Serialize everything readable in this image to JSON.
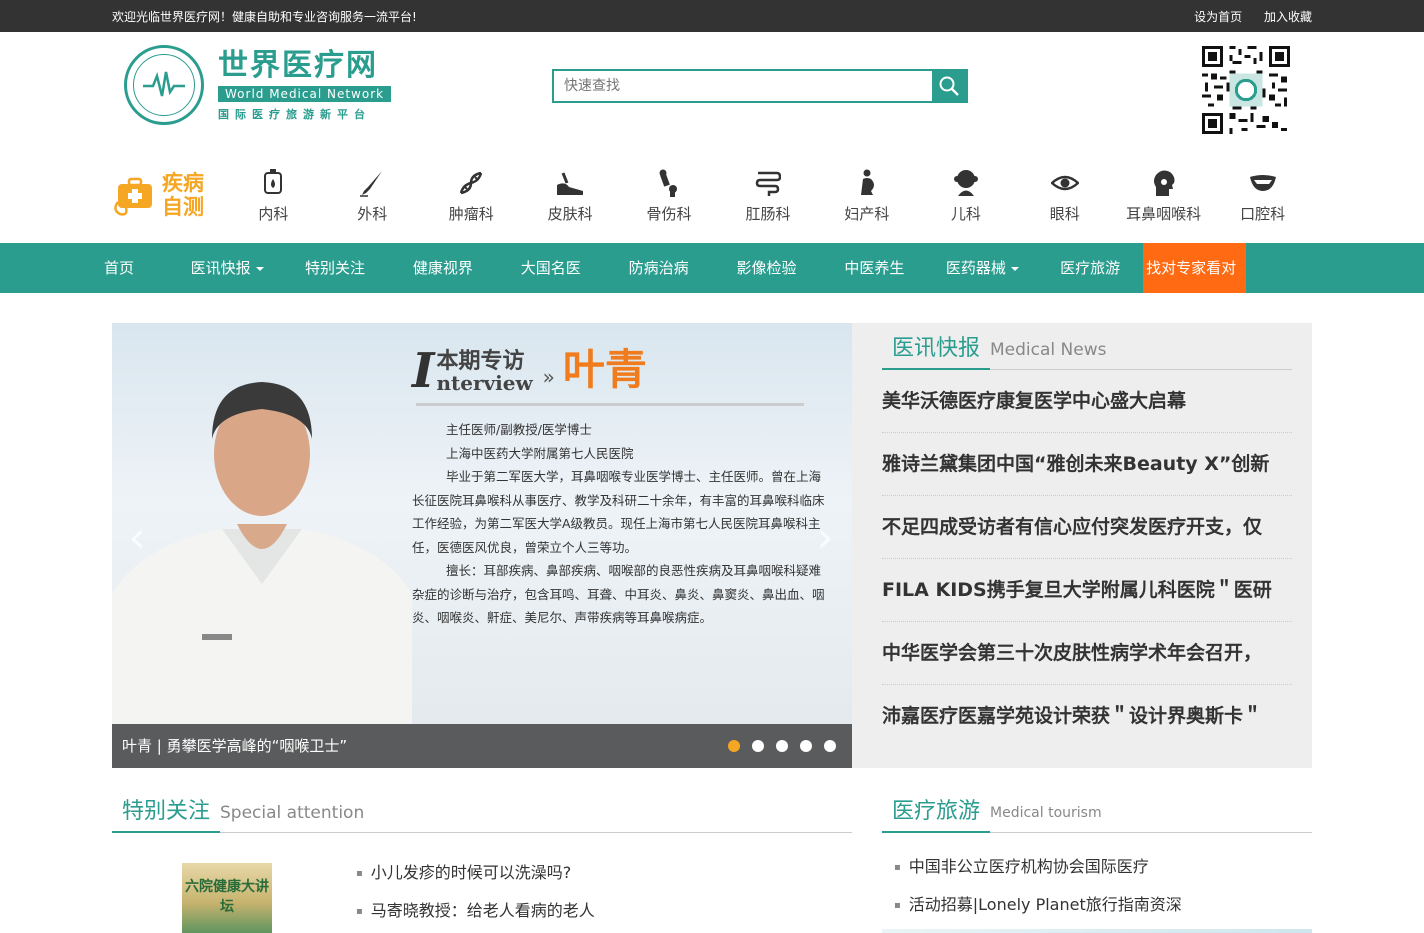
{
  "topbar": {
    "welcome": "欢迎光临世界医疗网！健康自助和专业咨询服务一流平台!",
    "set_home": "设为首页",
    "add_fav": "加入收藏"
  },
  "logo": {
    "cn": "世界医疗网",
    "en": "World Medical Network",
    "sub": "国际医疗旅游新平台",
    "ring_text": "世界医疗网 world medical network"
  },
  "search": {
    "placeholder": "快速查找"
  },
  "selftest": {
    "line1": "疾病",
    "line2": "自测"
  },
  "departments": [
    {
      "label": "内科",
      "icon": "iv-drip-icon"
    },
    {
      "label": "外科",
      "icon": "scalpel-icon"
    },
    {
      "label": "肿瘤科",
      "icon": "dna-icon"
    },
    {
      "label": "皮肤科",
      "icon": "skin-icon"
    },
    {
      "label": "骨伤科",
      "icon": "bone-icon"
    },
    {
      "label": "肛肠科",
      "icon": "intestine-icon"
    },
    {
      "label": "妇产科",
      "icon": "pregnant-icon"
    },
    {
      "label": "儿科",
      "icon": "child-icon"
    },
    {
      "label": "眼科",
      "icon": "eye-icon"
    },
    {
      "label": "耳鼻咽喉科",
      "icon": "head-profile-icon"
    },
    {
      "label": "口腔科",
      "icon": "mouth-icon"
    }
  ],
  "nav": [
    {
      "label": "首页"
    },
    {
      "label": "医讯快报"
    },
    {
      "label": "特别关注"
    },
    {
      "label": "健康视界"
    },
    {
      "label": "大国名医"
    },
    {
      "label": "防病治病"
    },
    {
      "label": "影像检验"
    },
    {
      "label": "中医养生"
    },
    {
      "label": "医药器械"
    },
    {
      "label": "医疗旅游"
    },
    {
      "label": "找对专家看对科"
    }
  ],
  "slider": {
    "title_cn": "本期专访",
    "title_en": "nterview",
    "title_i": "I",
    "name": "叶青",
    "lines": [
      "主任医师/副教授/医学博士",
      "上海中医药大学附属第七人民医院",
      "毕业于第二军医大学，耳鼻咽喉专业医学博士、主任医师。曾在上海长征医院耳鼻喉科从事医疗、教学及科研二十余年，有丰富的耳鼻喉科临床工作经验，为第二军医大学A级教员。现任上海市第七人民医院耳鼻喉科主任，医德医风优良，曾荣立个人三等功。",
      "擅长：耳部疾病、鼻部疾病、咽喉部的良恶性疾病及耳鼻咽喉科疑难杂症的诊断与治疗，包含耳鸣、耳聋、中耳炎、鼻炎、鼻窦炎、鼻出血、咽炎、咽喉炎、鼾症、美尼尔、声带疾病等耳鼻喉病症。"
    ],
    "caption": "叶青 | 勇攀医学高峰的“咽喉卫士”"
  },
  "news": {
    "title_cn": "医讯快报",
    "title_en": "Medical News",
    "items": [
      "美华沃德医疗康复医学中心盛大启幕",
      "雅诗兰黛集团中国“雅创未来Beauty X”创新",
      "不足四成受访者有信心应付突发医疗开支，仅",
      "FILA KIDS携手复旦大学附属儿科医院＂医研",
      "中华医学会第三十次皮肤性病学术年会召开，",
      "沛嘉医疗医嘉学苑设计荣获＂设计界奥斯卡＂"
    ]
  },
  "special": {
    "title_cn": "特别关注",
    "title_en": "Special attention",
    "image_text": "六院健康大讲坛",
    "items": [
      "小儿发疹的时候可以洗澡吗?",
      "马寄晓教授：给老人看病的老人"
    ]
  },
  "tourism": {
    "title_cn": "医疗旅游",
    "title_en": "Medical tourism",
    "items": [
      "中国非公立医疗机构协会国际医疗",
      "活动招募|Lonely Planet旅行指南资深"
    ]
  },
  "colors": {
    "brand": "#2a9d8f",
    "accent": "#ff6a13",
    "selftest": "#f5a623",
    "active_dot": "#f5a623"
  }
}
